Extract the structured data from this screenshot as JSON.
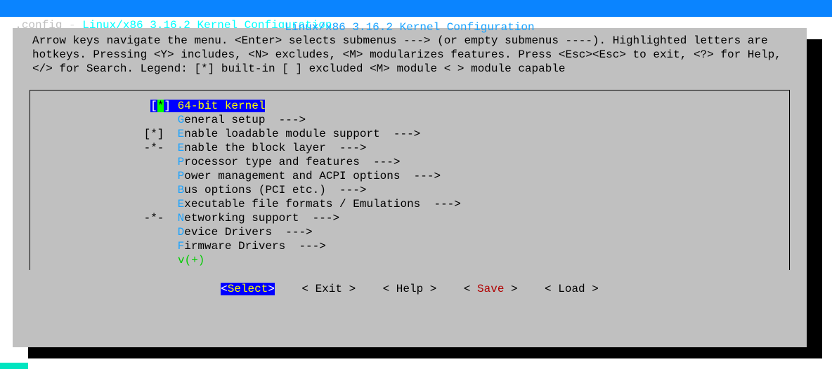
{
  "topbar": {
    "dot": ".",
    "config": "config",
    "dash": " - ",
    "title": "Linux/x86 3.16.2 Kernel Configuration"
  },
  "frame_title": "Linux/x86 3.16.2 Kernel Configuration",
  "help_text": "Arrow keys navigate the menu.  <Enter> selects submenus ---> (or empty submenus ----).  Highlighted letters are hotkeys.  Pressing <Y> includes, <N> excludes, <M> modularizes features.  Press <Esc><Esc> to exit, <?> for Help, </> for Search.  Legend: [*] built-in  [ ] excluded  <M> module  < > module capable",
  "menu": {
    "sel_prefix_l": "[",
    "sel_star": "*",
    "sel_prefix_r": "]",
    "sel_space": " ",
    "sel_label": "64-bit kernel",
    "items": [
      {
        "prefix": "    ",
        "hot": "G",
        "rest": "eneral setup  --->"
      },
      {
        "prefix": "[*] ",
        "hot": "E",
        "rest": "nable loadable module support  --->"
      },
      {
        "prefix": "-*- ",
        "hot": "E",
        "rest": "nable the block layer  --->"
      },
      {
        "prefix": "    ",
        "hot": "P",
        "rest": "rocessor type and features  --->"
      },
      {
        "prefix": "    ",
        "hot": "P",
        "rest": "ower management and ACPI options  --->"
      },
      {
        "prefix": "    ",
        "hot": "B",
        "rest": "us options (PCI etc.)  --->"
      },
      {
        "prefix": "    ",
        "hot": "E",
        "rest": "xecutable file formats / Emulations  --->"
      },
      {
        "prefix": "-*- ",
        "hot": "N",
        "rest": "e",
        "rest2": "tworking support  --->"
      },
      {
        "prefix": "    ",
        "hot": "D",
        "rest": "evice Drivers  --->"
      },
      {
        "prefix": "    ",
        "hot": "F",
        "rest": "irmware Drivers  --->"
      }
    ],
    "more": "v(+)"
  },
  "buttons": {
    "select_l": "<",
    "select_t": "Select",
    "select_r": ">",
    "exit": "< Exit >",
    "help": "< Help >",
    "save_l": "< ",
    "save_t": "Save",
    "save_r": " >",
    "load": "< Load >",
    "gap": "    "
  }
}
